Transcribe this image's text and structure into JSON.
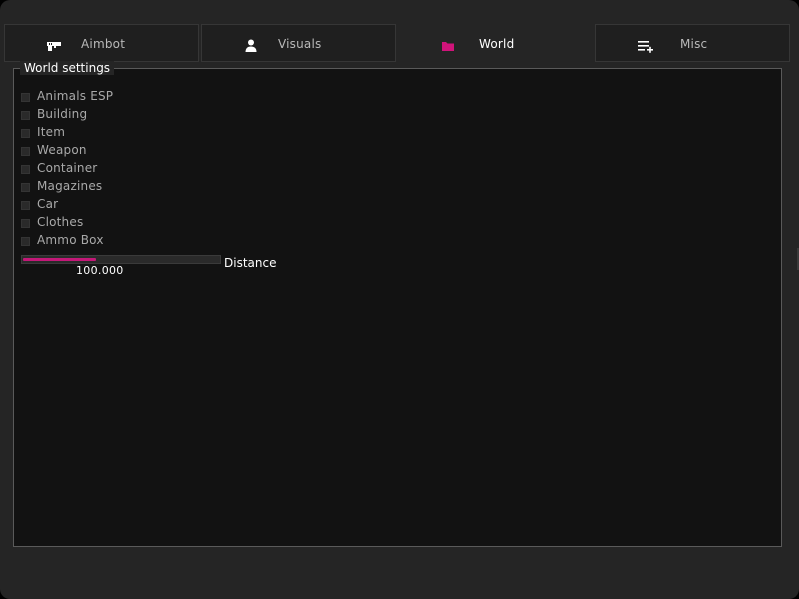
{
  "tabs": [
    {
      "label": "Aimbot",
      "icon": "gun-icon",
      "active": false
    },
    {
      "label": "Visuals",
      "icon": "person-icon",
      "active": false
    },
    {
      "label": "World",
      "icon": "folder-icon",
      "active": true
    },
    {
      "label": "Misc",
      "icon": "list-add-icon",
      "active": false
    }
  ],
  "world_settings": {
    "title": "World settings",
    "checkboxes": [
      {
        "label": "Animals ESP",
        "checked": false
      },
      {
        "label": "Building",
        "checked": false
      },
      {
        "label": "Item",
        "checked": false
      },
      {
        "label": "Weapon",
        "checked": false
      },
      {
        "label": "Container",
        "checked": false
      },
      {
        "label": "Magazines",
        "checked": false
      },
      {
        "label": "Car",
        "checked": false
      },
      {
        "label": "Clothes",
        "checked": false
      },
      {
        "label": "Ammo Box",
        "checked": false
      }
    ],
    "distance_slider": {
      "label": "Distance",
      "value_text": "100.000",
      "fill_fraction": 0.37
    }
  },
  "colors": {
    "accent": "#c41878",
    "window_bg": "#252525",
    "panel_bg": "#121212"
  }
}
